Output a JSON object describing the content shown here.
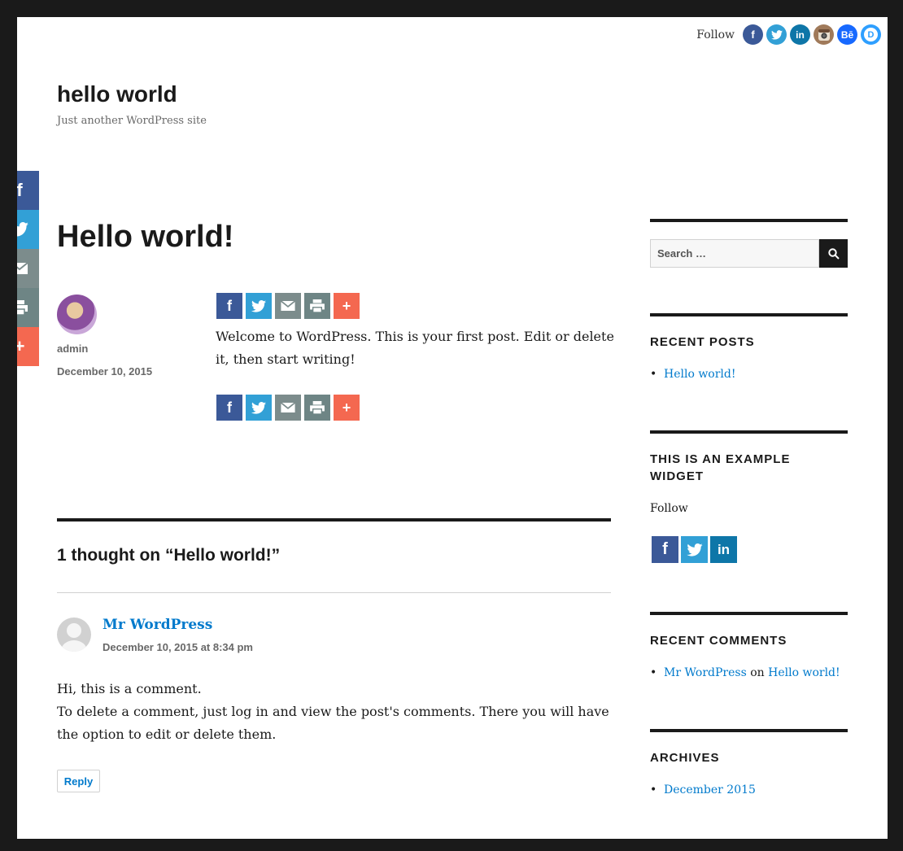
{
  "follow_bar": {
    "label": "Follow",
    "icons": [
      {
        "name": "facebook-icon",
        "glyph": "f",
        "color": "#3b5998"
      },
      {
        "name": "twitter-icon",
        "glyph": "t",
        "color": "#32a0d6"
      },
      {
        "name": "linkedin-icon",
        "glyph": "in",
        "color": "#0e76a8"
      },
      {
        "name": "instagram-icon",
        "glyph": "◉",
        "color": "#8a6d55"
      },
      {
        "name": "behance-icon",
        "glyph": "Bē",
        "color": "#1769ff"
      },
      {
        "name": "disqus-icon",
        "glyph": "D",
        "color": "#2e9fff"
      }
    ]
  },
  "site": {
    "title": "hello world",
    "description": "Just another WordPress site"
  },
  "float_share": [
    "facebook-icon",
    "twitter-icon",
    "email-icon",
    "print-icon",
    "more-icon"
  ],
  "post": {
    "title": "Hello world!",
    "author": "admin",
    "date": "December 10, 2015",
    "content": "Welcome to WordPress. This is your first post. Edit or delete it, then start writing!"
  },
  "comments": {
    "title": "1 thought on “Hello world!”",
    "items": [
      {
        "author": "Mr WordPress",
        "date": "December 10, 2015 at 8:34 pm",
        "line1": "Hi, this is a comment.",
        "line2": "To delete a comment, just log in and view the post's comments. There you will have the option to edit or delete them.",
        "reply_label": "Reply"
      }
    ]
  },
  "sidebar": {
    "search_placeholder": "Search …",
    "recent_posts": {
      "title": "RECENT POSTS",
      "items": [
        "Hello world!"
      ]
    },
    "example_widget": {
      "title": "THIS IS AN EXAMPLE WIDGET",
      "follow_label": "Follow"
    },
    "recent_comments": {
      "title": "RECENT COMMENTS",
      "author": "Mr WordPress",
      "on": "on",
      "post": "Hello world!"
    },
    "archives": {
      "title": "ARCHIVES",
      "items": [
        "December 2015"
      ]
    }
  },
  "colors": {
    "accent_link": "#007acc",
    "facebook": "#3b5998",
    "twitter": "#32a0d6",
    "email": "#7c8c8c",
    "print": "#6e8585",
    "more": "#f46850"
  }
}
